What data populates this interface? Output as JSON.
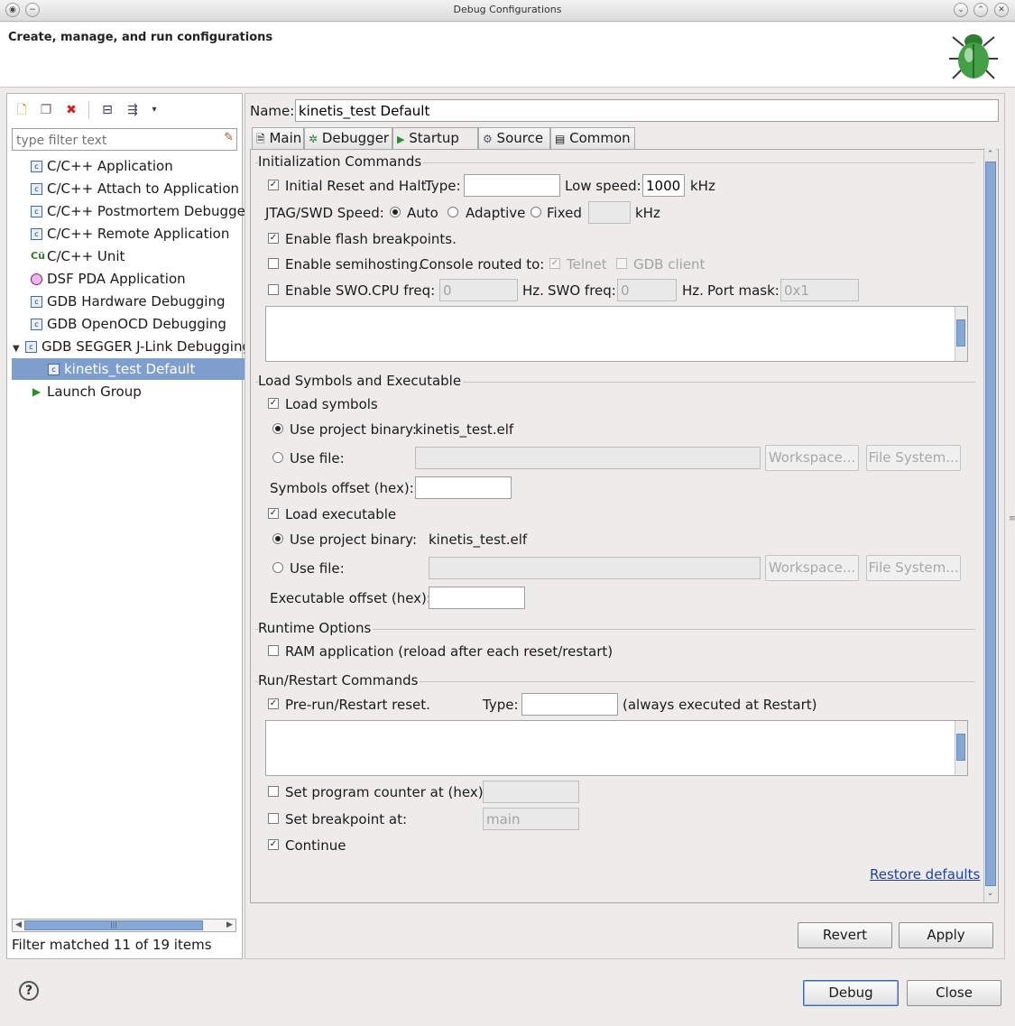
{
  "window": {
    "title": "Debug Configurations"
  },
  "header": {
    "title": "Create, manage, and run configurations"
  },
  "sidebar": {
    "filter_placeholder": "type filter text",
    "items": [
      {
        "label": "C/C++ Application",
        "icon": "c-app-icon"
      },
      {
        "label": "C/C++ Attach to Application",
        "icon": "c-app-icon"
      },
      {
        "label": "C/C++ Postmortem Debugger",
        "icon": "c-app-icon"
      },
      {
        "label": "C/C++ Remote Application",
        "icon": "c-app-icon"
      },
      {
        "label": "C/C++ Unit",
        "icon": "c-unit-icon"
      },
      {
        "label": "DSF PDA Application",
        "icon": "pda-icon"
      },
      {
        "label": "GDB Hardware Debugging",
        "icon": "c-app-icon"
      },
      {
        "label": "GDB OpenOCD Debugging",
        "icon": "c-app-icon"
      },
      {
        "label": "GDB SEGGER J-Link Debugging",
        "icon": "c-app-icon"
      },
      {
        "label": "kinetis_test Default",
        "icon": "c-app-icon"
      },
      {
        "label": "Launch Group",
        "icon": "launch-group-icon"
      }
    ],
    "status": "Filter matched 11 of 19 items"
  },
  "config": {
    "name_label": "Name:",
    "name_value": "kinetis_test Default",
    "tabs": [
      {
        "label": "Main"
      },
      {
        "label": "Debugger"
      },
      {
        "label": "Startup"
      },
      {
        "label": "Source"
      },
      {
        "label": "Common"
      }
    ]
  },
  "startup": {
    "init": {
      "title": "Initialization Commands",
      "reset_halt": "Initial Reset and Halt.",
      "type_label": "Type:",
      "type_value": "",
      "low_speed_label": "Low speed:",
      "low_speed_value": "1000",
      "khz": "kHz",
      "jtag_label": "JTAG/SWD Speed:",
      "auto": "Auto",
      "adaptive": "Adaptive",
      "fixed": "Fixed",
      "flash_bp": "Enable flash breakpoints.",
      "semihosting": "Enable semihosting.",
      "console_routed": "Console routed to:",
      "telnet": "Telnet",
      "gdb_client": "GDB client",
      "swo": "Enable SWO.",
      "cpu_freq": "CPU freq:",
      "cpu_freq_value": "0",
      "hz": "Hz.",
      "swo_freq": "SWO freq:",
      "swo_freq_value": "0",
      "hz2": "Hz.",
      "port_mask": "Port mask:",
      "port_mask_value": "0x1"
    },
    "load": {
      "title": "Load Symbols and Executable",
      "load_symbols": "Load symbols",
      "use_project_binary": "Use project binary:",
      "symbols_binary": "kinetis_test.elf",
      "use_file": "Use file:",
      "workspace": "Workspace...",
      "file_system": "File System...",
      "symbols_offset": "Symbols offset (hex):",
      "load_exec": "Load executable",
      "exec_binary": "kinetis_test.elf",
      "exec_offset": "Executable offset (hex):"
    },
    "runtime": {
      "title": "Runtime Options",
      "ram_app": "RAM application (reload after each reset/restart)"
    },
    "restart": {
      "title": "Run/Restart Commands",
      "prerun": "Pre-run/Restart reset.",
      "type_label": "Type:",
      "always": "(always executed at Restart)",
      "set_pc": "Set program counter at (hex):",
      "set_bp": "Set breakpoint at:",
      "bp_value": "main",
      "continue": "Continue"
    },
    "restore_defaults": "Restore defaults"
  },
  "buttons": {
    "revert": "Revert",
    "apply": "Apply",
    "debug": "Debug",
    "close": "Close"
  }
}
